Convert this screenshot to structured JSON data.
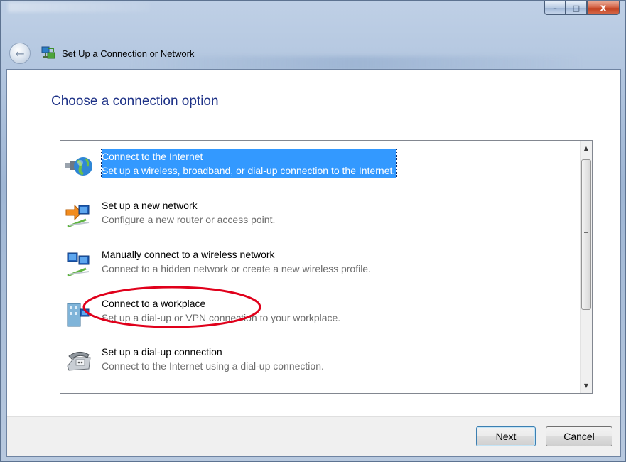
{
  "window": {
    "title": "Set Up a Connection or Network",
    "caption_buttons": {
      "minimize": "–",
      "maximize": "□",
      "close": "x"
    }
  },
  "page": {
    "heading": "Choose a connection option"
  },
  "options": [
    {
      "title": "Connect to the Internet",
      "description": "Set up a wireless, broadband, or dial-up connection to the Internet.",
      "icon": "globe-connect-icon",
      "selected": true
    },
    {
      "title": "Set up a new network",
      "description": "Configure a new router or access point.",
      "icon": "new-network-icon",
      "selected": false
    },
    {
      "title": "Manually connect to a wireless network",
      "description": "Connect to a hidden network or create a new wireless profile.",
      "icon": "wireless-network-icon",
      "selected": false
    },
    {
      "title": "Connect to a workplace",
      "description": "Set up a dial-up or VPN connection to your workplace.",
      "icon": "workplace-icon",
      "selected": false,
      "annotated": true
    },
    {
      "title": "Set up a dial-up connection",
      "description": "Connect to the Internet using a dial-up connection.",
      "icon": "dialup-phone-icon",
      "selected": false
    }
  ],
  "buttons": {
    "next": "Next",
    "cancel": "Cancel"
  },
  "colors": {
    "heading": "#1e3287",
    "selection": "#3399ff",
    "annotation": "#e0001b"
  }
}
